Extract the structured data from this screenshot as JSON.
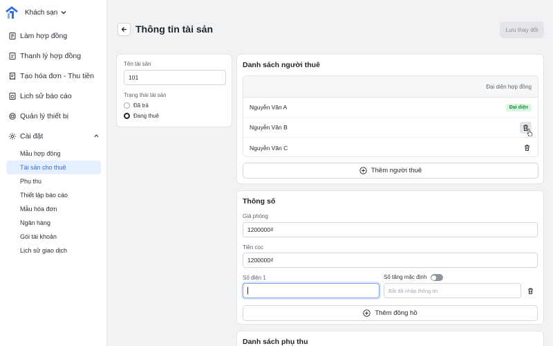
{
  "sidebar": {
    "brand_name": "Khách sạn",
    "items": [
      {
        "label": "Làm hợp đồng",
        "icon": "contract-icon"
      },
      {
        "label": "Thanh lý hợp đồng",
        "icon": "contract-end-icon"
      },
      {
        "label": "Tạo hóa đơn - Thu tiền",
        "icon": "invoice-icon"
      },
      {
        "label": "Lịch sử báo cáo",
        "icon": "report-history-icon"
      },
      {
        "label": "Quản lý thiết bị",
        "icon": "device-icon"
      }
    ],
    "settings": {
      "label": "Cài đặt",
      "icon": "gear-icon",
      "subitems": [
        "Mẫu hợp đồng",
        "Tài sản cho thuê",
        "Phụ thu",
        "Thiết lập báo cáo",
        "Mẫu hóa đơn",
        "Ngân hàng",
        "Gói tài khoản",
        "Lịch sử giao dịch"
      ],
      "active_index": 1
    }
  },
  "header": {
    "title": "Thông tin tài sản",
    "save_label": "Lưu thay đổi"
  },
  "asset": {
    "name_label": "Tên tài sản",
    "name_value": "101",
    "status_label": "Trạng thái tài sản",
    "status_options": [
      "Đã trả",
      "Đang thuê"
    ],
    "status_selected": "Đang thuê"
  },
  "tenants": {
    "title": "Danh sách người thuê",
    "column_header": "Đại diện hợp đồng",
    "rows": [
      {
        "name": "Nguyễn Văn A",
        "badge": "Đại diện"
      },
      {
        "name": "Nguyễn Văn B"
      },
      {
        "name": "Nguyễn Văn C"
      }
    ],
    "add_label": "Thêm người thuê"
  },
  "params": {
    "title": "Thông số",
    "room_price_label": "Giá phòng",
    "room_price_value": "1200000₫",
    "deposit_label": "Tiền cọc",
    "deposit_value": "1200000₫",
    "meter_label": "Số điện 1",
    "meter_value": "",
    "default_increase_label": "Số tăng mặc định",
    "default_increase_placeholder": "Bắt đầ nhập thông tin",
    "default_increase_enabled": false,
    "add_meter_label": "Thêm đồng hồ"
  },
  "surcharge": {
    "title": "Danh sách phụ thu"
  },
  "colors": {
    "accent": "#2f6fe4",
    "active_bg": "#e6efff",
    "badge_bg": "#dcf5e3",
    "badge_text": "#1d8a3f"
  }
}
